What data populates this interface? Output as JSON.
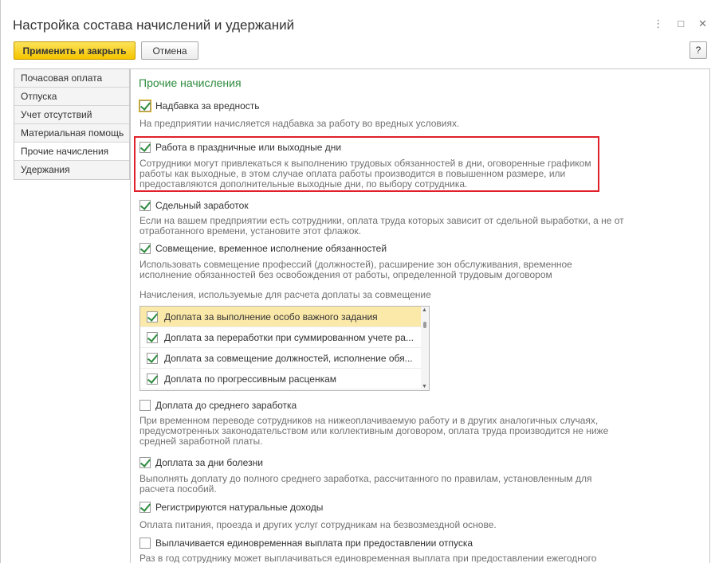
{
  "window": {
    "title": "Настройка состава начислений и удержаний",
    "menu_glyph": "⋮",
    "maximize_glyph": "□",
    "close_glyph": "✕"
  },
  "toolbar": {
    "apply_label": "Применить и закрыть",
    "cancel_label": "Отмена",
    "help_label": "?"
  },
  "sidebar": {
    "items": [
      {
        "label": "Почасовая оплата",
        "active": false
      },
      {
        "label": "Отпуска",
        "active": false
      },
      {
        "label": "Учет отсутствий",
        "active": false
      },
      {
        "label": "Материальная помощь",
        "active": false
      },
      {
        "label": "Прочие начисления",
        "active": true
      },
      {
        "label": "Удержания",
        "active": false
      }
    ]
  },
  "main": {
    "section_title": "Прочие начисления",
    "options": [
      {
        "label": "Надбавка за вредность",
        "checked": true,
        "desc": "На предприятии начисляется надбавка за работу во вредных условиях."
      },
      {
        "label": "Работа в праздничные или выходные дни",
        "checked": true,
        "desc": "Сотрудники могут привлекаться к выполнению трудовых обязанностей в дни, оговоренные графиком работы как выходные, в этом случае оплата работы производится в повышенном размере, или предоставляются дополнительные выходные дни, по выбору сотрудника."
      },
      {
        "label": "Сдельный заработок",
        "checked": true,
        "desc": "Если на вашем предприятии есть сотрудники, оплата труда которых зависит от сдельной выработки, а не от отработанного времени, установите этот флажок."
      },
      {
        "label": "Совмещение, временное исполнение обязанностей",
        "checked": true,
        "desc": "Использовать совмещение профессий (должностей), расширение зон обслуживания, временное исполнение обязанностей без освобождения от работы, определенной трудовым договором"
      },
      {
        "label": "Доплата до среднего заработка",
        "checked": false,
        "desc": "При временном переводе сотрудников на нижеоплачиваемую работу и в других аналогичных случаях, предусмотренных законодательством или коллективным договором, оплата труда производится не ниже средней заработной платы."
      },
      {
        "label": "Доплата за дни болезни",
        "checked": true,
        "desc": "Выполнять доплату до полного среднего заработка, рассчитанного по правилам, установленным для расчета пособий."
      },
      {
        "label": "Регистрируются натуральные доходы",
        "checked": true,
        "desc": "Оплата питания, проезда и других услуг сотрудникам на безвозмездной основе."
      },
      {
        "label": "Выплачивается единовременная выплата при предоставлении отпуска",
        "checked": false,
        "desc": "Раз в год сотруднику может выплачиваться единовременная выплата при предоставлении ежегодного"
      }
    ],
    "combination_list": {
      "caption": "Начисления, используемые для расчета доплаты за совмещение",
      "items": [
        {
          "label": "Доплата за выполнение особо важного задания",
          "checked": true,
          "selected": true
        },
        {
          "label": "Доплата за переработки при суммированном учете ра...",
          "checked": true,
          "selected": false
        },
        {
          "label": "Доплата за совмещение должностей, исполнение обя...",
          "checked": true,
          "selected": false
        },
        {
          "label": "Доплата по прогрессивным расценкам",
          "checked": true,
          "selected": false
        }
      ]
    }
  }
}
